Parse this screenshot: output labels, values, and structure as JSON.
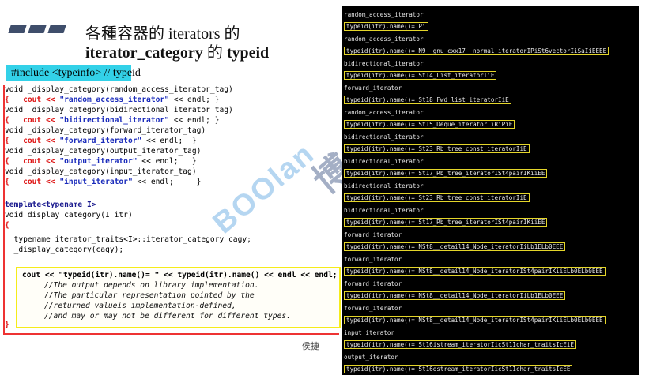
{
  "slide": {
    "title_line1": "各種容器的 iterators 的",
    "title_line2_en": "iterator_category",
    "title_line2_cjk": " 的 ",
    "title_line2_end": "typeid",
    "include_note": "#include <typeinfo>  // typeid",
    "author": "侯捷"
  },
  "code": {
    "overloads": [
      {
        "sig": "void _display_category(random_access_iterator_tag)",
        "body_pre": "{   cout << ",
        "str": "\"random_access_iterator\"",
        "body_post": " << endl; }"
      },
      {
        "sig": "void _display_category(bidirectional_iterator_tag)",
        "body_pre": "{   cout << ",
        "str": "\"bidirectional_iterator\"",
        "body_post": " << endl; }"
      },
      {
        "sig": "void _display_category(forward_iterator_tag)",
        "body_pre": "{   cout << ",
        "str": "\"forward_iterator\"",
        "body_post": " << endl;  }"
      },
      {
        "sig": "void _display_category(output_iterator_tag)",
        "body_pre": "{   cout << ",
        "str": "\"output_iterator\"",
        "body_post": " << endl;   }"
      },
      {
        "sig": "void _display_category(input_iterator_tag)",
        "body_pre": "{   cout << ",
        "str": "\"input_iterator\"",
        "body_post": " << endl;     }"
      }
    ],
    "template_line": "template<typename I>",
    "func_sig": "void display_category(I itr)",
    "open_brace": "{",
    "typedef_line": "  typename iterator_traits<I>::iterator_category cagy;",
    "call_line": "  _display_category(cagy);",
    "cout_line": "cout << \"typeid(itr).name()= \" << typeid(itr).name() << endl << endl;",
    "comments": [
      "//The output depends on library implementation.",
      "//The particular representation pointed by the",
      "//returned valueis implementation-defined,",
      "//and may or may not be different for different types."
    ],
    "close_brace": "}"
  },
  "watermark": {
    "text": "BOOlan",
    "seal": "博"
  },
  "console": {
    "blocks": [
      {
        "cat": "random_access_iterator",
        "type": "typeid(itr).name()= Pi"
      },
      {
        "cat": "random_access_iterator",
        "type": "typeid(itr).name()= N9__gnu_cxx17__normal_iteratorIPiSt6vectorIiSaIiEEEE"
      },
      {
        "cat": "bidirectional_iterator",
        "type": "typeid(itr).name()= St14_List_iteratorIiE"
      },
      {
        "cat": "forward_iterator",
        "type": "typeid(itr).name()= St18_Fwd_list_iteratorIiE"
      },
      {
        "cat": "random_access_iterator",
        "type": "typeid(itr).name()= St15_Deque_iteratorIiRiPiE"
      },
      {
        "cat": "bidirectional_iterator",
        "type": "typeid(itr).name()= St23_Rb_tree_const_iteratorIiE"
      },
      {
        "cat": "bidirectional_iterator",
        "type": "typeid(itr).name()= St17_Rb_tree_iteratorISt4pairIKiiEE"
      },
      {
        "cat": "bidirectional_iterator",
        "type": "typeid(itr).name()= St23_Rb_tree_const_iteratorIiE"
      },
      {
        "cat": "bidirectional_iterator",
        "type": "typeid(itr).name()= St17_Rb_tree_iteratorISt4pairIKiiEE"
      },
      {
        "cat": "forward_iterator",
        "type": "typeid(itr).name()= NSt8__detail14_Node_iteratorIiLb1ELb0EEE"
      },
      {
        "cat": "forward_iterator",
        "type": "typeid(itr).name()= NSt8__detail14_Node_iteratorISt4pairIKiiELb0ELb0EEE"
      },
      {
        "cat": "forward_iterator",
        "type": "typeid(itr).name()= NSt8__detail14_Node_iteratorIiLb1ELb0EEE"
      },
      {
        "cat": "forward_iterator",
        "type": "typeid(itr).name()= NSt8__detail14_Node_iteratorISt4pairIKiiELb0ELb0EEE"
      },
      {
        "cat": "input_iterator",
        "type": "typeid(itr).name()= St16istream_iteratorIicSt11char_traitsIcEiE"
      },
      {
        "cat": "output_iterator",
        "type": "typeid(itr).name()= St16ostream_iteratorIicSt11char_traitsIcEE"
      }
    ]
  },
  "colors": {
    "include_bg": "#33d1e8",
    "highlight_box": "#f5ec1a",
    "code_border": "#e33",
    "console_bg": "#000000",
    "console_box": "#e4d52a"
  }
}
